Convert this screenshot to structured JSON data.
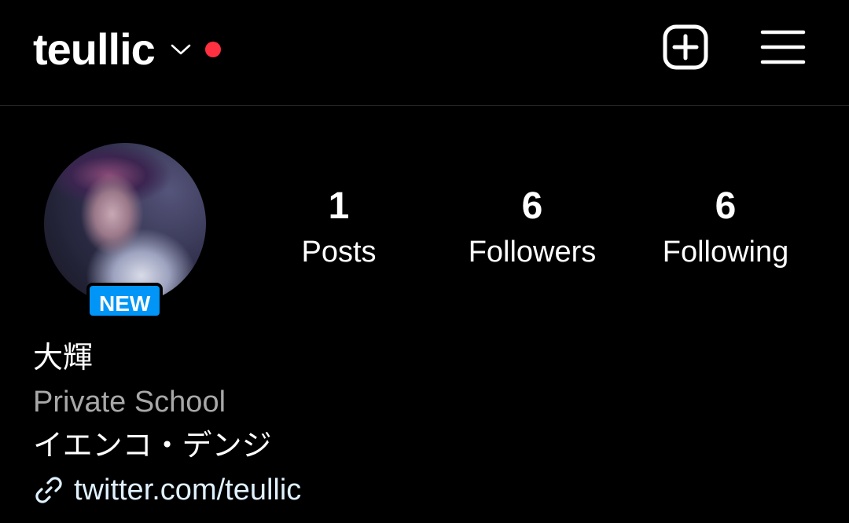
{
  "header": {
    "username": "teullic",
    "has_notification": true,
    "notification_color": "#ff3040",
    "new_post_icon": "plus-square-icon",
    "menu_icon": "hamburger-menu-icon",
    "chevron_icon": "chevron-down-icon"
  },
  "profile": {
    "new_badge": "NEW",
    "badge_color": "#0095f6",
    "stats": {
      "posts": {
        "count": "1",
        "label": "Posts"
      },
      "followers": {
        "count": "6",
        "label": "Followers"
      },
      "following": {
        "count": "6",
        "label": "Following"
      }
    },
    "name": "大輝",
    "category": "Private School",
    "bio": "イエンコ・デンジ",
    "link": {
      "icon": "link-icon",
      "text": "twitter.com/teullic",
      "color": "#e0f1ff"
    }
  }
}
